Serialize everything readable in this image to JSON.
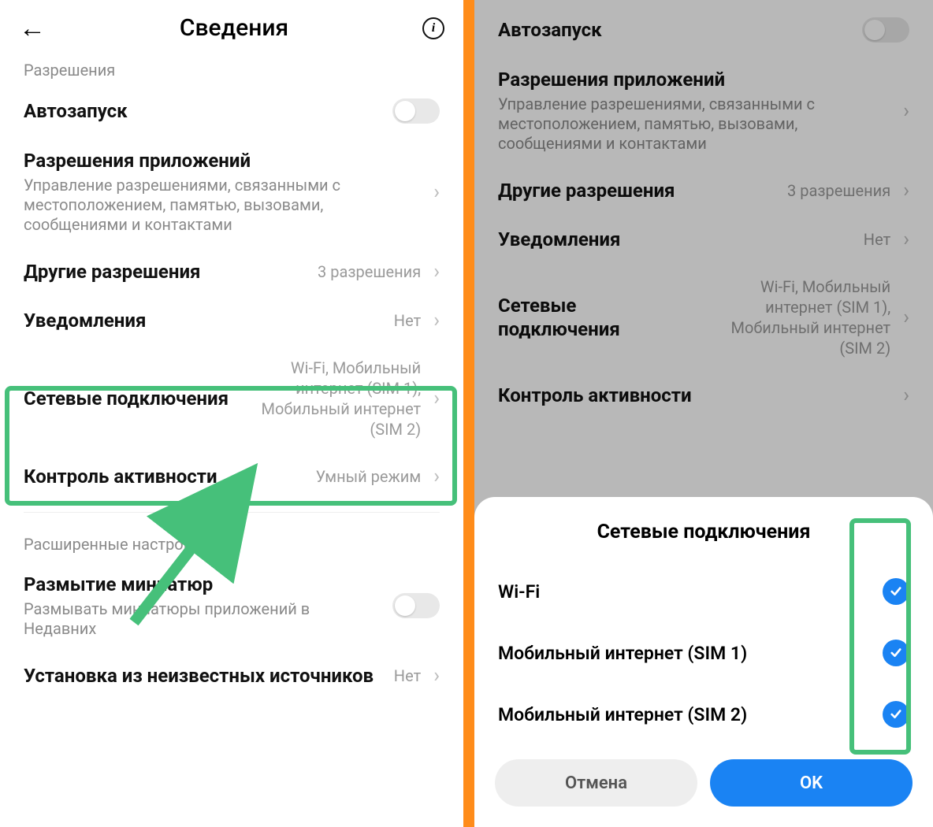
{
  "left": {
    "header_title": "Сведения",
    "section_permissions": "Разрешения",
    "autostart": "Автозапуск",
    "app_perms_title": "Разрешения приложений",
    "app_perms_sub": "Управление разрешениями, связанными с местоположением, памятью, вызовами, сообщениями и контактами",
    "other_perms_title": "Другие разрешения",
    "other_perms_value": "3 разрешения",
    "notifications_title": "Уведомления",
    "notifications_value": "Нет",
    "network_title": "Сетевые подключения",
    "network_value": "Wi-Fi, Мобильный интернет (SIM 1), Мобильный интернет (SIM 2)",
    "activity_title": "Контроль активности",
    "activity_value": "Умный режим",
    "section_advanced": "Расширенные настройки",
    "blur_title": "Размытие миниатюр",
    "blur_sub": "Размывать миниатюры приложений в Недавних",
    "unknown_title": "Установка из неизвестных источников",
    "unknown_value": "Нет"
  },
  "right": {
    "autostart": "Автозапуск",
    "app_perms_title": "Разрешения приложений",
    "app_perms_sub": "Управление разрешениями, связанными с местоположением, памятью, вызовами, сообщениями и контактами",
    "other_perms_title": "Другие разрешения",
    "other_perms_value": "3 разрешения",
    "notifications_title": "Уведомления",
    "notifications_value": "Нет",
    "network_title": "Сетевые подключения",
    "network_value": "Wi-Fi, Мобильный интернет (SIM 1), Мобильный интернет (SIM 2)",
    "activity_title": "Контроль активности"
  },
  "modal": {
    "title": "Сетевые подключения",
    "options": [
      "Wi-Fi",
      "Мобильный интернет (SIM 1)",
      "Мобильный интернет (SIM 2)"
    ],
    "cancel": "Отмена",
    "ok": "OK"
  }
}
